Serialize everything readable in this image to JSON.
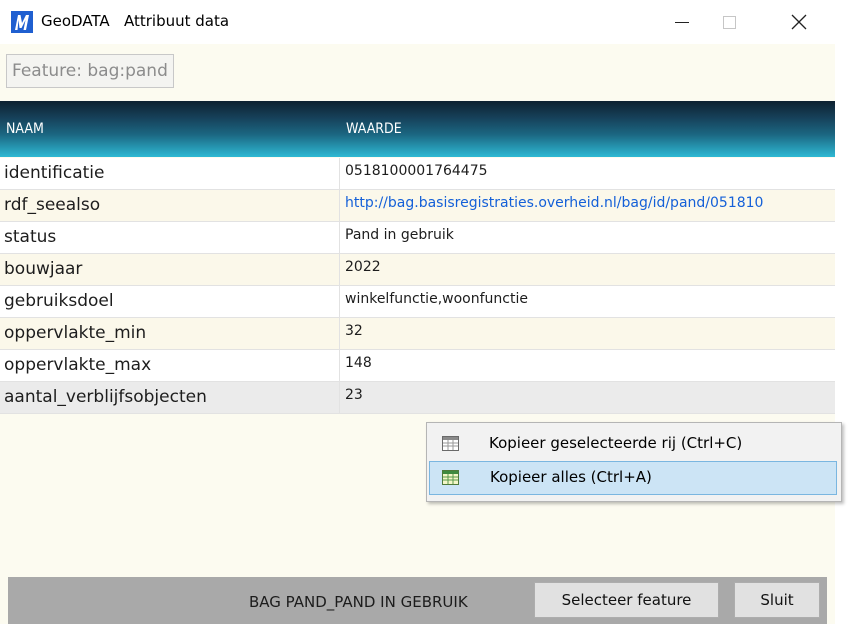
{
  "window": {
    "app_name": "GeoDATA",
    "title": "Attribuut data",
    "controls": {
      "minimize": "minimize-icon",
      "maximize": "maximize-icon",
      "close": "close-icon"
    }
  },
  "feature_label": "Feature: bag:pand",
  "grid": {
    "headers": {
      "name": "NAAM",
      "value": "WAARDE"
    },
    "rows": [
      {
        "name": "identificatie",
        "value": "0518100001764475"
      },
      {
        "name": "rdf_seealso",
        "value": "http://bag.basisregistraties.overheid.nl/bag/id/pand/051810"
      },
      {
        "name": "status",
        "value": "Pand in gebruik"
      },
      {
        "name": "bouwjaar",
        "value": "2022"
      },
      {
        "name": "gebruiksdoel",
        "value": "winkelfunctie,woonfunctie"
      },
      {
        "name": "oppervlakte_min",
        "value": "32"
      },
      {
        "name": "oppervlakte_max",
        "value": "148"
      },
      {
        "name": "aantal_verblijfsobjecten",
        "value": "23"
      }
    ]
  },
  "context_menu": {
    "items": [
      {
        "label": "Kopieer geselecteerde rij (Ctrl+C)",
        "icon": "table-icon"
      },
      {
        "label": "Kopieer alles (Ctrl+A)",
        "icon": "table-icon"
      }
    ]
  },
  "statusbar": {
    "text": "BAG PAND_PAND IN GEBRUIK",
    "select_button": "Selecteer feature",
    "close_button": "Sluit"
  },
  "colors": {
    "header_gradient_top": "#0d2130",
    "header_gradient_bottom": "#2eb9d4",
    "link": "#1460d8",
    "menu_highlight": "#cce4f5",
    "row_alt": "#fbf8ea",
    "window_bg": "#fcfbf0"
  }
}
